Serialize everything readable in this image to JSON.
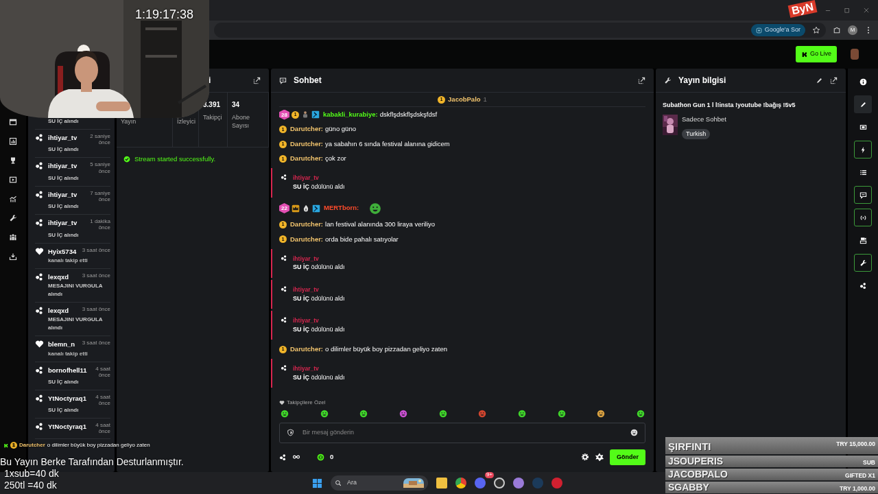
{
  "overlay": {
    "timer": "1:19:17:38",
    "logo": "ByN",
    "chat_line": {
      "badge": "1",
      "user": "Darutcher",
      "text": "o dilimler büyük boy pizzadan geliyo zaten"
    },
    "notes": [
      "Bu Yayın Berke Tarafından Desturlanmıştır.",
      "1xsub=40 dk",
      "250tl =40 dk"
    ],
    "leaderboard": [
      {
        "name": "ŞIRFINTI",
        "amount": "TRY 15,000.00"
      },
      {
        "name": "JSOUPERIS",
        "amount": "SUB"
      },
      {
        "name": "JACOBPALO",
        "amount": "GIFTED X1"
      },
      {
        "name": "SGABBY",
        "amount": "TRY 1,000.00"
      }
    ]
  },
  "browser": {
    "lens_chip": "Google'a Sor",
    "profile": "M"
  },
  "header": {
    "go_live": "Go Live"
  },
  "feed": [
    {
      "kind": "reward",
      "text": "**SU İÇ** alındı"
    },
    {
      "kind": "reward",
      "user": "ihtiyar_tv",
      "time": "2 saniye önce",
      "text": "**SU İÇ** alındı"
    },
    {
      "kind": "reward",
      "user": "ihtiyar_tv",
      "time": "5 saniye önce",
      "text": "**SU İÇ** alındı"
    },
    {
      "kind": "reward",
      "user": "ihtiyar_tv",
      "time": "7 saniye önce",
      "text": "**SU İÇ** alındı"
    },
    {
      "kind": "reward",
      "user": "ihtiyar_tv",
      "time": "1 dakika önce",
      "text": "**SU İÇ** alındı"
    },
    {
      "kind": "follow",
      "user": "Hyix5734",
      "time": "3 saat önce",
      "text": "kanalı takip etti"
    },
    {
      "kind": "reward",
      "user": "lexqxd",
      "time": "3 saat önce",
      "text": "**MESAJINI VURGULA** alındı"
    },
    {
      "kind": "reward",
      "user": "lexqxd",
      "time": "3 saat önce",
      "text": "**MESAJINI VURGULA** alındı"
    },
    {
      "kind": "follow",
      "user": "blemn_n",
      "time": "3 saat önce",
      "text": "kanalı takip etti"
    },
    {
      "kind": "reward",
      "user": "bornofhell11",
      "time": "4 saat önce",
      "text": "**SU İÇ** alındı"
    },
    {
      "kind": "reward",
      "user": "YtNoctyraq1",
      "time": "4 saat önce",
      "text": "**SU İÇ** alındı"
    },
    {
      "kind": "reward",
      "user": "YtNoctyraq1",
      "time": "4 saat önce"
    }
  ],
  "stats": {
    "title": "i",
    "items": [
      {
        "label": "Yayın"
      },
      {
        "label": "İzleyici"
      },
      {
        "value": "3.391",
        "label": "Takipçi"
      },
      {
        "value": "34",
        "label": "Abone Sayısı"
      }
    ],
    "message": "Stream started successfully."
  },
  "chat": {
    "title": "Sohbet",
    "pinned": {
      "badge": "1",
      "user": "JacobPalo",
      "count": "1"
    },
    "messages": [
      {
        "kind": "message",
        "badges": [
          {
            "kind": "subscriber",
            "label": "28"
          },
          {
            "kind": "gifter",
            "label": "1"
          },
          {
            "kind": "figure"
          },
          {
            "kind": "moderator"
          }
        ],
        "user": "kabakli_kurabiye:",
        "color": "#53fc18",
        "text": "dskflşdskflşdskşfdsf"
      },
      {
        "kind": "message",
        "badges": [
          {
            "kind": "gifter",
            "label": "1"
          }
        ],
        "user": "Darutcher:",
        "color": "#f3c56e",
        "text": "güno güno"
      },
      {
        "kind": "message",
        "badges": [
          {
            "kind": "gifter",
            "label": "1"
          }
        ],
        "user": "Darutcher:",
        "color": "#f3c56e",
        "text": "ya sabahın 6 sında festival alanına gidicem"
      },
      {
        "kind": "message",
        "badges": [
          {
            "kind": "gifter",
            "label": "1"
          }
        ],
        "user": "Darutcher:",
        "color": "#f3c56e",
        "text": "çok zor"
      },
      {
        "kind": "reward",
        "user": "ihtiyar_tv",
        "color": "#d7264f",
        "text": "**SU İÇ** ödülünü aldı"
      },
      {
        "kind": "message",
        "badges": [
          {
            "kind": "subscriber",
            "label": "22"
          },
          {
            "kind": "crown"
          },
          {
            "kind": "flame"
          },
          {
            "kind": "moderator"
          }
        ],
        "user": "MERTborn:",
        "color": "#ff4b2b",
        "emote": true
      },
      {
        "kind": "message",
        "badges": [
          {
            "kind": "gifter",
            "label": "1"
          }
        ],
        "user": "Darutcher:",
        "color": "#f3c56e",
        "text": "lan festival alanında 300 liraya veriliyo"
      },
      {
        "kind": "message",
        "badges": [
          {
            "kind": "gifter",
            "label": "1"
          }
        ],
        "user": "Darutcher:",
        "color": "#f3c56e",
        "text": "orda bide pahalı satıyolar"
      },
      {
        "kind": "reward",
        "user": "ihtiyar_tv",
        "color": "#d7264f",
        "text": "**SU İÇ** ödülünü aldı"
      },
      {
        "kind": "reward",
        "user": "ihtiyar_tv",
        "color": "#d7264f",
        "text": "**SU İÇ** ödülünü aldı"
      },
      {
        "kind": "reward",
        "user": "ihtiyar_tv",
        "color": "#d7264f",
        "text": "**SU İÇ** ödülünü aldı"
      },
      {
        "kind": "message",
        "badges": [
          {
            "kind": "gifter",
            "label": "1"
          }
        ],
        "user": "Darutcher:",
        "color": "#f3c56e",
        "text": "o dilimler büyük boy pizzadan geliyo zaten"
      },
      {
        "kind": "reward",
        "user": "ihtiyar_tv",
        "color": "#d7264f",
        "text": "**SU İÇ** ödülünü aldı"
      }
    ],
    "emote_label": "Takipçilere Özel",
    "emotes": [
      {
        "color": "#3fd42a"
      },
      {
        "color": "#3fd42a"
      },
      {
        "color": "#3fd42a"
      },
      {
        "color": "#c84fd0"
      },
      {
        "color": "#3fd42a"
      },
      {
        "color": "#d0452e"
      },
      {
        "color": "#3fd42a"
      },
      {
        "color": "#3fd42a"
      },
      {
        "color": "#d8a040"
      },
      {
        "color": "#3fd42a"
      }
    ],
    "placeholder": "Bir mesaj gönderin",
    "points": "0",
    "send": "Gönder"
  },
  "info": {
    "title": "Yayın bilgisi",
    "stream_title": "Subathon Gun 1 l l!insta !youtube !bağış !5v5",
    "category": "Sadece Sohbet",
    "tag": "Turkish"
  },
  "right_rail": [
    {
      "selected": false,
      "highlighted": false
    },
    {
      "selected": true,
      "highlighted": false
    },
    {
      "selected": false,
      "highlighted": false
    },
    {
      "selected": false,
      "highlighted": true
    },
    {
      "selected": false,
      "highlighted": false
    },
    {
      "selected": false,
      "highlighted": true
    },
    {
      "selected": false,
      "highlighted": true
    },
    {
      "selected": false,
      "highlighted": false
    },
    {
      "selected": false,
      "highlighted": true
    },
    {
      "selected": false,
      "highlighted": false
    }
  ],
  "taskbar": {
    "search": "Ara",
    "discord_badge": "9+"
  }
}
